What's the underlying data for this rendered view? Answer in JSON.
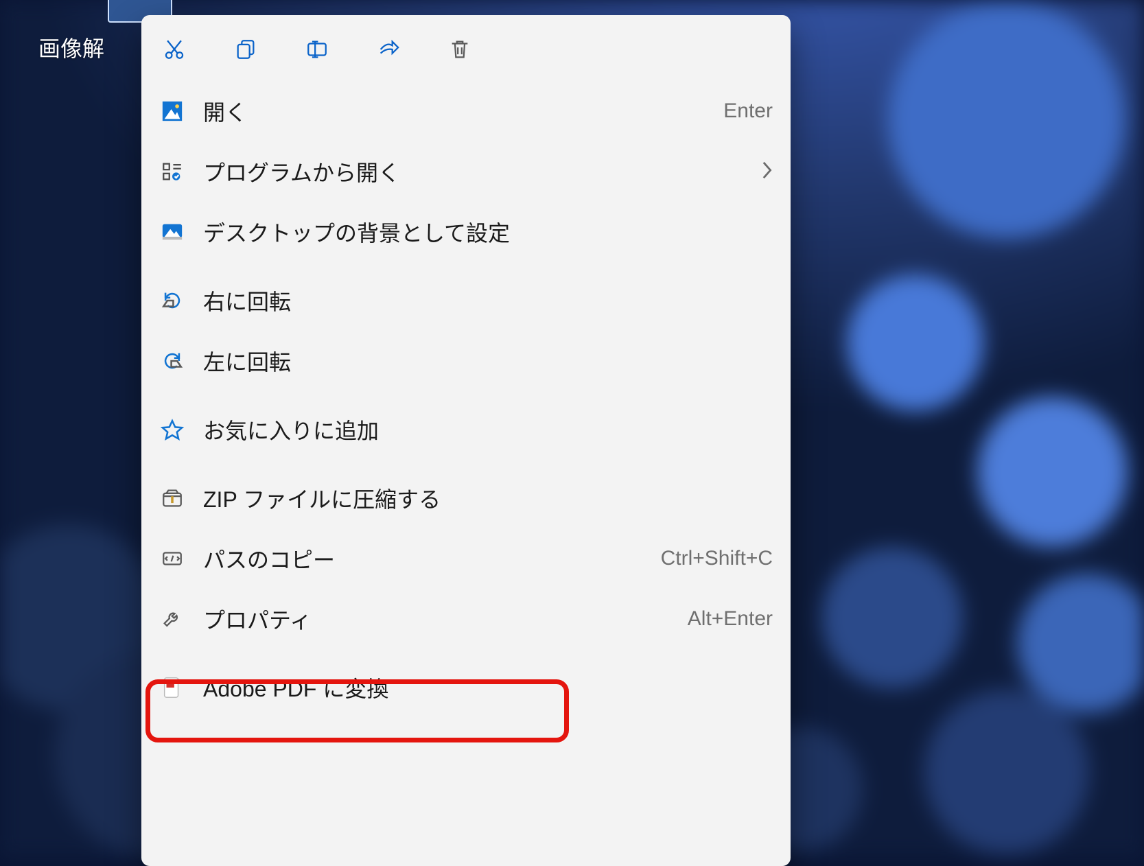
{
  "desktop": {
    "file_label": "画像解"
  },
  "toolbar": {
    "cut": "cut",
    "copy": "copy",
    "rename": "rename",
    "share": "share",
    "delete": "delete"
  },
  "menu": {
    "open": {
      "label": "開く",
      "shortcut": "Enter"
    },
    "open_with": {
      "label": "プログラムから開く"
    },
    "set_background": {
      "label": "デスクトップの背景として設定"
    },
    "rotate_right": {
      "label": "右に回転"
    },
    "rotate_left": {
      "label": "左に回転"
    },
    "add_favorites": {
      "label": "お気に入りに追加"
    },
    "compress_zip": {
      "label": "ZIP ファイルに圧縮する"
    },
    "copy_path": {
      "label": "パスのコピー",
      "shortcut": "Ctrl+Shift+C"
    },
    "properties": {
      "label": "プロパティ",
      "shortcut": "Alt+Enter"
    },
    "convert_pdf": {
      "label": "Adobe PDF に変換"
    }
  },
  "highlighted_item": "properties"
}
